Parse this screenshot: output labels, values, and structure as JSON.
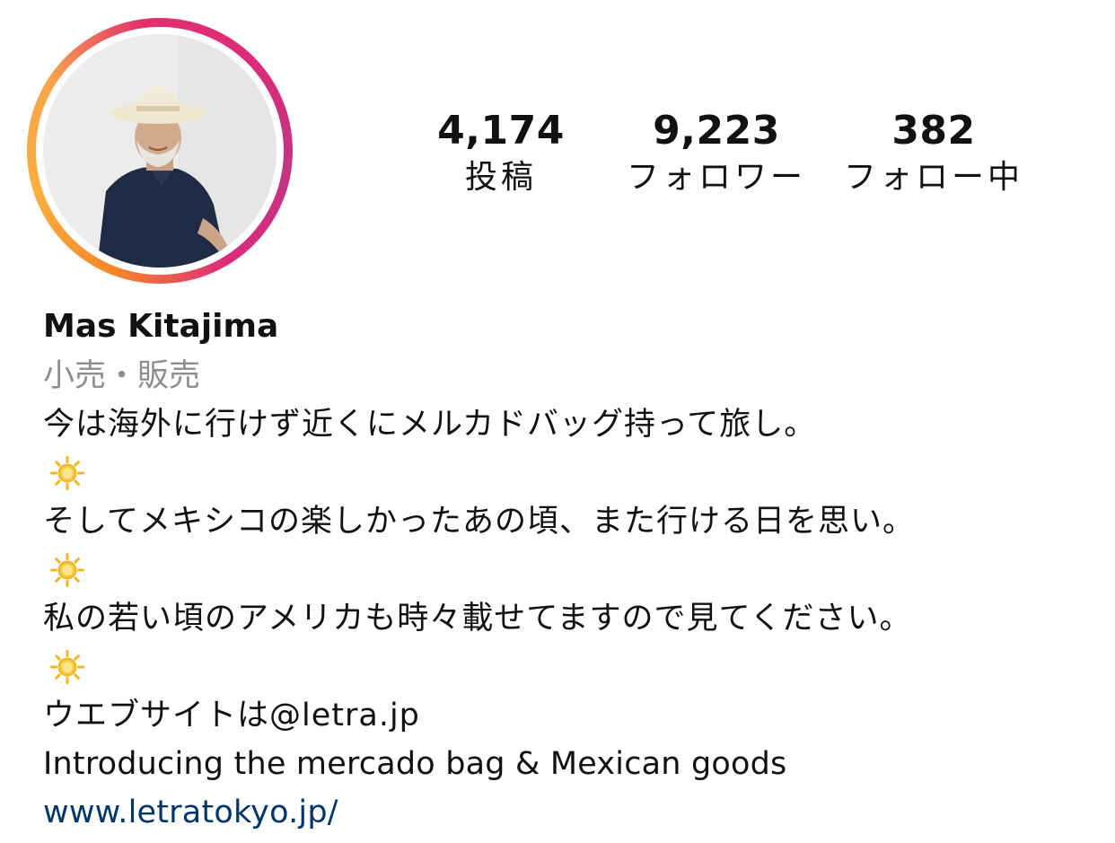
{
  "profile": {
    "stats": {
      "posts": {
        "count": "4,174",
        "label": "投稿"
      },
      "followers": {
        "count": "9,223",
        "label": "フォロワー"
      },
      "following": {
        "count": "382",
        "label": "フォロー中"
      }
    },
    "name": "Mas Kitajima",
    "category": "小売・販売",
    "bio": {
      "line1": "今は海外に行けず近くにメルカドバッグ持って旅し。",
      "line2": "そしてメキシコの楽しかったあの頃、また行ける日を思い。",
      "line3": "私の若い頃のアメリカも時々載せてますので見てください。",
      "line4": "ウエブサイトは@letra.jp",
      "line5": "Introducing the mercado bag & Mexican goods"
    },
    "sun_icon": "sun-emoji",
    "website": "www.letratokyo.jp/"
  },
  "colors": {
    "ring_start": "#f58529",
    "ring_end": "#dd2a7b",
    "link": "#00376b",
    "category": "#8e8e8e"
  }
}
